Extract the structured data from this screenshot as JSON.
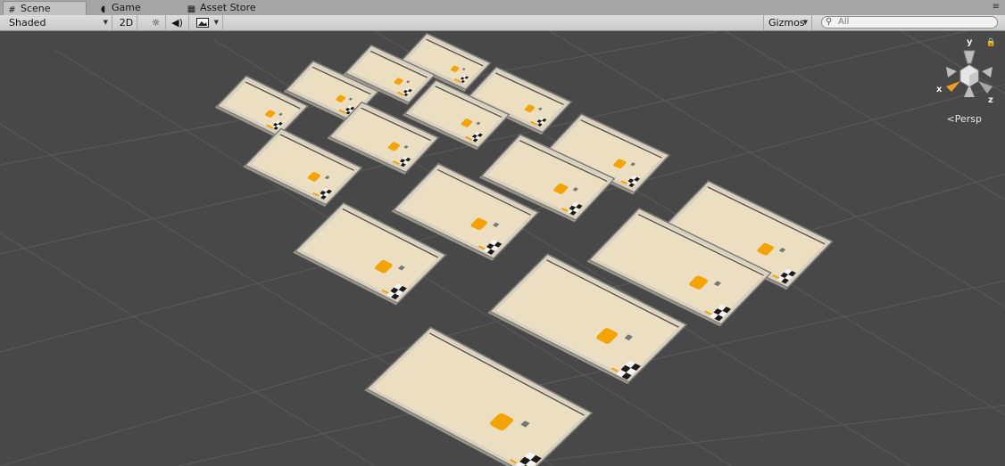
{
  "tabs": [
    {
      "label": "Scene",
      "icon": "grid-icon",
      "active": true
    },
    {
      "label": "Game",
      "icon": "pacman-icon",
      "active": false
    },
    {
      "label": "Asset Store",
      "icon": "store-icon",
      "active": false
    }
  ],
  "toolbar": {
    "shading_mode": "Shaded",
    "mode_2d": "2D",
    "gizmos_label": "Gizmos",
    "search_placeholder": "All"
  },
  "gizmo": {
    "y_label": "y",
    "x_label": "x",
    "z_label": "z",
    "projection": "Persp"
  },
  "colors": {
    "scene_background": "#484848",
    "grid_line": "#5a5a5a",
    "tray_floor": "#ecdfc1",
    "tray_wall": "#d8d0c0",
    "player_cube": "#f5a300",
    "finish_checker": "#1a1a1a"
  }
}
